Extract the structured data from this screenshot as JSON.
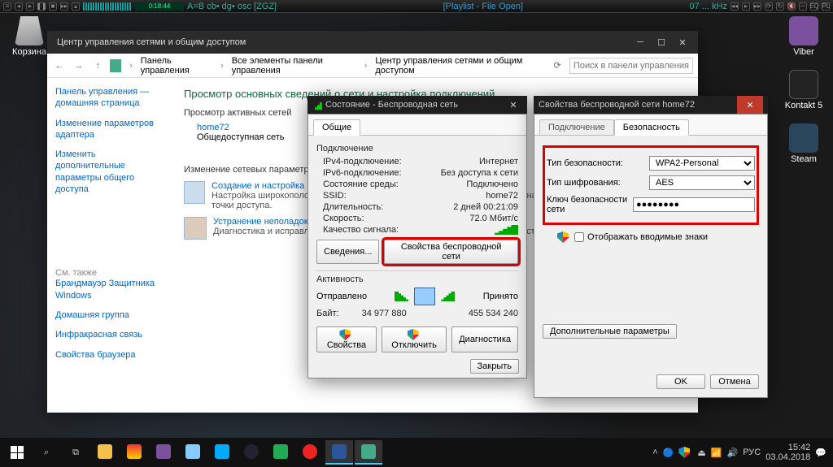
{
  "player": {
    "lcd_time": "0:18:44",
    "track_info": "A=B cb• dg• osc [ZGZ]",
    "title": "[Playlist - File Open]",
    "right_info": "07 ... kHz"
  },
  "desktop": {
    "recycle": "Корзина",
    "viber": "Viber",
    "kontakt": "Kontakt 5",
    "steam": "Steam"
  },
  "cp": {
    "title": "Центр управления сетями и общим доступом",
    "crumbs": [
      "Панель управления",
      "Все элементы панели управления",
      "Центр управления сетями и общим доступом"
    ],
    "search_placeholder": "Поиск в панели управления",
    "side": {
      "home": "Панель управления — домашняя страница",
      "adapters": "Изменение параметров адаптера",
      "sharing": "Изменить дополнительные параметры общего доступа",
      "see_also": "См. также",
      "firewall": "Брандмауэр Защитника Windows",
      "homegroup": "Домашняя группа",
      "ir": "Инфракрасная связь",
      "inet": "Свойства браузера"
    },
    "main": {
      "heading": "Просмотр основных сведений о сети и настройка подключений",
      "active_label": "Просмотр активных сетей",
      "net_name": "home72",
      "net_type": "Общедоступная сеть",
      "change_label": "Изменение сетевых параметров",
      "task1_title": "Создание и настройка нового подключения или сети",
      "task1_sub": "Настройка широкополосного, коммутируемого или VPN-подключения либо настройка маршрутизатора или точки доступа.",
      "task2_title": "Устранение неполадок",
      "task2_sub": "Диагностика и исправление проблем с сетью или получение сведений об устранении неполадок."
    }
  },
  "status": {
    "title": "Состояние - Беспроводная сеть",
    "tab_general": "Общие",
    "group_conn": "Подключение",
    "ipv4_k": "IPv4-подключение:",
    "ipv4_v": "Интернет",
    "ipv6_k": "IPv6-подключение:",
    "ipv6_v": "Без доступа к сети",
    "state_k": "Состояние среды:",
    "state_v": "Подключено",
    "ssid_k": "SSID:",
    "ssid_v": "home72",
    "dur_k": "Длительность:",
    "dur_v": "2 дней 00:21:09",
    "speed_k": "Скорость:",
    "speed_v": "72.0 Мбит/с",
    "quality_k": "Качество сигнала:",
    "btn_details": "Сведения...",
    "btn_wprops": "Свойства беспроводной сети",
    "group_activity": "Активность",
    "sent": "Отправлено",
    "recv": "Принято",
    "bytes_k": "Байт:",
    "bytes_sent": "34 977 880",
    "bytes_recv": "455 534 240",
    "btn_props": "Свойства",
    "btn_disable": "Отключить",
    "btn_diag": "Диагностика",
    "btn_close": "Закрыть"
  },
  "props": {
    "title": "Свойства беспроводной сети home72",
    "tab_conn": "Подключение",
    "tab_sec": "Безопасность",
    "sec_type_label": "Тип безопасности:",
    "sec_type_value": "WPA2-Personal",
    "enc_label": "Тип шифрования:",
    "enc_value": "AES",
    "key_label": "Ключ безопасности сети",
    "key_value": "●●●●●●●●",
    "show_chars": "Отображать вводимые знаки",
    "btn_advanced": "Дополнительные параметры",
    "btn_ok": "OK",
    "btn_cancel": "Отмена"
  },
  "taskbar": {
    "lang": "РУС",
    "time": "15:42",
    "date": "03.04.2018"
  }
}
